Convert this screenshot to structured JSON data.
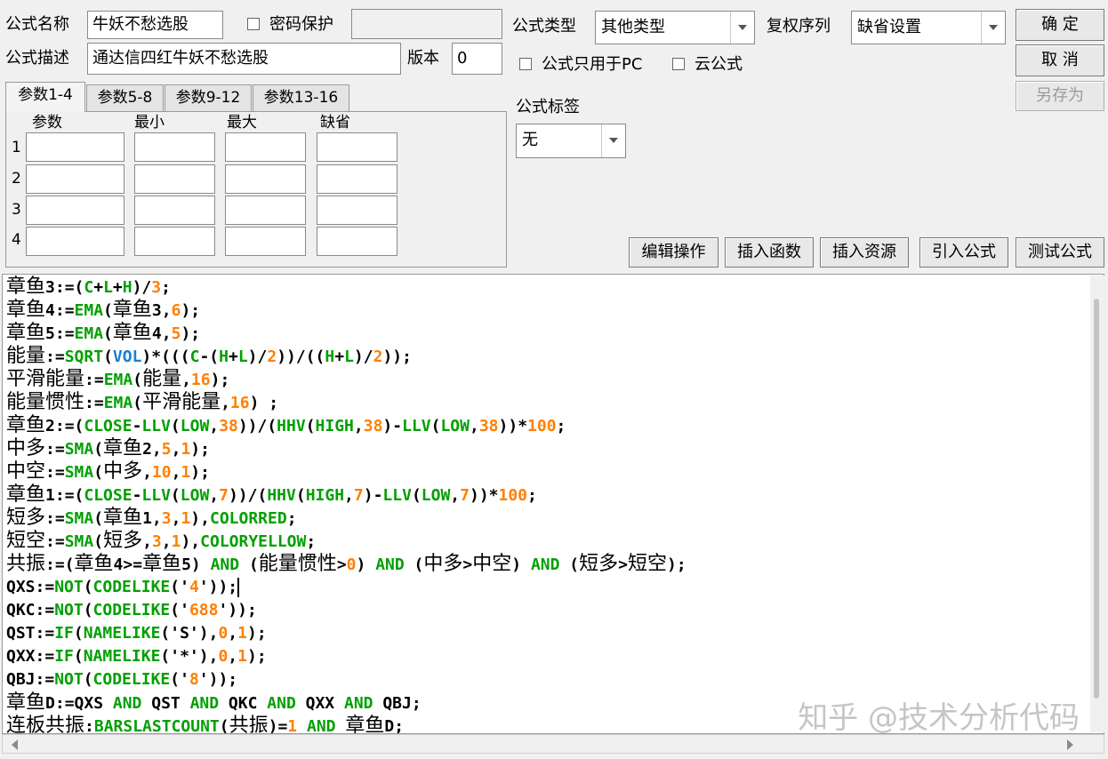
{
  "header": {
    "name_label": "公式名称",
    "name_value": "牛妖不愁选股",
    "password_label": "密码保护",
    "password_value": "",
    "desc_label": "公式描述",
    "desc_value": "通达信四红牛妖不愁选股",
    "version_label": "版本",
    "version_value": "0",
    "type_label": "公式类型",
    "type_value": "其他类型",
    "rights_label": "复权序列",
    "rights_value": "缺省设置",
    "pc_only_label": "公式只用于PC",
    "cloud_label": "云公式",
    "tag_label": "公式标签",
    "tag_value": "无"
  },
  "buttons": {
    "ok": "确  定",
    "cancel": "取  消",
    "save_as": "另存为",
    "edit_ops": "编辑操作",
    "insert_func": "插入函数",
    "insert_res": "插入资源",
    "import_formula": "引入公式",
    "test_formula": "测试公式"
  },
  "params": {
    "tabs": [
      "参数1-4",
      "参数5-8",
      "参数9-12",
      "参数13-16"
    ],
    "active_tab": 0,
    "columns": [
      "参数",
      "最小",
      "最大",
      "缺省"
    ],
    "rows": [
      "1",
      "2",
      "3",
      "4"
    ]
  },
  "editor": {
    "lines": [
      [
        [
          "章鱼",
          "cn"
        ],
        [
          "3:=(",
          ""
        ],
        [
          "C",
          "g"
        ],
        [
          "+",
          ""
        ],
        [
          "L",
          "g"
        ],
        [
          "+",
          ""
        ],
        [
          "H",
          "g"
        ],
        [
          ")/",
          ""
        ],
        [
          "3",
          "o"
        ],
        [
          ";",
          ""
        ]
      ],
      [
        [
          "章鱼",
          "cn"
        ],
        [
          "4:=",
          ""
        ],
        [
          "EMA",
          "g"
        ],
        [
          "(",
          ""
        ],
        [
          "章鱼",
          "cn"
        ],
        [
          "3,",
          ""
        ],
        [
          "6",
          "o"
        ],
        [
          ");",
          ""
        ]
      ],
      [
        [
          "章鱼",
          "cn"
        ],
        [
          "5:=",
          ""
        ],
        [
          "EMA",
          "g"
        ],
        [
          "(",
          ""
        ],
        [
          "章鱼",
          "cn"
        ],
        [
          "4,",
          ""
        ],
        [
          "5",
          "o"
        ],
        [
          ");",
          ""
        ]
      ],
      [
        [
          "能量",
          "cn"
        ],
        [
          ":=",
          ""
        ],
        [
          "SQRT",
          "g"
        ],
        [
          "(",
          ""
        ],
        [
          "VOL",
          "b"
        ],
        [
          ")*(((",
          ""
        ],
        [
          "C",
          "g"
        ],
        [
          "-(",
          ""
        ],
        [
          "H",
          "g"
        ],
        [
          "+",
          ""
        ],
        [
          "L",
          "g"
        ],
        [
          ")/",
          ""
        ],
        [
          "2",
          "o"
        ],
        [
          "))/((",
          ""
        ],
        [
          "H",
          "g"
        ],
        [
          "+",
          ""
        ],
        [
          "L",
          "g"
        ],
        [
          ")/",
          ""
        ],
        [
          "2",
          "o"
        ],
        [
          "));",
          ""
        ]
      ],
      [
        [
          "平滑能量",
          "cn"
        ],
        [
          ":=",
          ""
        ],
        [
          "EMA",
          "g"
        ],
        [
          "(",
          ""
        ],
        [
          "能量",
          "cn"
        ],
        [
          ",",
          ""
        ],
        [
          "16",
          "o"
        ],
        [
          ");",
          ""
        ]
      ],
      [
        [
          "能量惯性",
          "cn"
        ],
        [
          ":=",
          ""
        ],
        [
          "EMA",
          "g"
        ],
        [
          "(",
          ""
        ],
        [
          "平滑能量",
          "cn"
        ],
        [
          ",",
          ""
        ],
        [
          "16",
          "o"
        ],
        [
          ") ;",
          ""
        ]
      ],
      [
        [
          "章鱼",
          "cn"
        ],
        [
          "2:=(",
          ""
        ],
        [
          "CLOSE",
          "g"
        ],
        [
          "-",
          ""
        ],
        [
          "LLV",
          "g"
        ],
        [
          "(",
          ""
        ],
        [
          "LOW",
          "g"
        ],
        [
          ",",
          ""
        ],
        [
          "38",
          "o"
        ],
        [
          "))/(",
          ""
        ],
        [
          "HHV",
          "g"
        ],
        [
          "(",
          ""
        ],
        [
          "HIGH",
          "g"
        ],
        [
          ",",
          ""
        ],
        [
          "38",
          "o"
        ],
        [
          ")-",
          ""
        ],
        [
          "LLV",
          "g"
        ],
        [
          "(",
          ""
        ],
        [
          "LOW",
          "g"
        ],
        [
          ",",
          ""
        ],
        [
          "38",
          "o"
        ],
        [
          "))*",
          ""
        ],
        [
          "100",
          "o"
        ],
        [
          ";",
          ""
        ]
      ],
      [
        [
          "中多",
          "cn"
        ],
        [
          ":=",
          ""
        ],
        [
          "SMA",
          "g"
        ],
        [
          "(",
          ""
        ],
        [
          "章鱼",
          "cn"
        ],
        [
          "2,",
          ""
        ],
        [
          "5",
          "o"
        ],
        [
          ",",
          ""
        ],
        [
          "1",
          "o"
        ],
        [
          ");",
          ""
        ]
      ],
      [
        [
          "中空",
          "cn"
        ],
        [
          ":=",
          ""
        ],
        [
          "SMA",
          "g"
        ],
        [
          "(",
          ""
        ],
        [
          "中多",
          "cn"
        ],
        [
          ",",
          ""
        ],
        [
          "10",
          "o"
        ],
        [
          ",",
          ""
        ],
        [
          "1",
          "o"
        ],
        [
          ");",
          ""
        ]
      ],
      [
        [
          "章鱼",
          "cn"
        ],
        [
          "1:=(",
          ""
        ],
        [
          "CLOSE",
          "g"
        ],
        [
          "-",
          ""
        ],
        [
          "LLV",
          "g"
        ],
        [
          "(",
          ""
        ],
        [
          "LOW",
          "g"
        ],
        [
          ",",
          ""
        ],
        [
          "7",
          "o"
        ],
        [
          "))/(",
          ""
        ],
        [
          "HHV",
          "g"
        ],
        [
          "(",
          ""
        ],
        [
          "HIGH",
          "g"
        ],
        [
          ",",
          ""
        ],
        [
          "7",
          "o"
        ],
        [
          ")-",
          ""
        ],
        [
          "LLV",
          "g"
        ],
        [
          "(",
          ""
        ],
        [
          "LOW",
          "g"
        ],
        [
          ",",
          ""
        ],
        [
          "7",
          "o"
        ],
        [
          "))*",
          ""
        ],
        [
          "100",
          "o"
        ],
        [
          ";",
          ""
        ]
      ],
      [
        [
          "短多",
          "cn"
        ],
        [
          ":=",
          ""
        ],
        [
          "SMA",
          "g"
        ],
        [
          "(",
          ""
        ],
        [
          "章鱼",
          "cn"
        ],
        [
          "1,",
          ""
        ],
        [
          "3",
          "o"
        ],
        [
          ",",
          ""
        ],
        [
          "1",
          "o"
        ],
        [
          "),",
          ""
        ],
        [
          "COLORRED",
          "g"
        ],
        [
          ";",
          ""
        ]
      ],
      [
        [
          "短空",
          "cn"
        ],
        [
          ":=",
          ""
        ],
        [
          "SMA",
          "g"
        ],
        [
          "(",
          ""
        ],
        [
          "短多",
          "cn"
        ],
        [
          ",",
          ""
        ],
        [
          "3",
          "o"
        ],
        [
          ",",
          ""
        ],
        [
          "1",
          "o"
        ],
        [
          "),",
          ""
        ],
        [
          "COLORYELLOW",
          "g"
        ],
        [
          ";",
          ""
        ]
      ],
      [
        [
          "共振",
          "cn"
        ],
        [
          ":=(",
          ""
        ],
        [
          "章鱼",
          "cn"
        ],
        [
          "4>=",
          ""
        ],
        [
          "章鱼",
          "cn"
        ],
        [
          "5) ",
          ""
        ],
        [
          "AND",
          "g"
        ],
        [
          " (",
          ""
        ],
        [
          "能量惯性",
          "cn"
        ],
        [
          ">",
          ""
        ],
        [
          "0",
          "o"
        ],
        [
          ") ",
          ""
        ],
        [
          "AND",
          "g"
        ],
        [
          " (",
          ""
        ],
        [
          "中多",
          "cn"
        ],
        [
          ">",
          ""
        ],
        [
          "中空",
          "cn"
        ],
        [
          ") ",
          ""
        ],
        [
          "AND",
          "g"
        ],
        [
          " (",
          ""
        ],
        [
          "短多",
          "cn"
        ],
        [
          ">",
          ""
        ],
        [
          "短空",
          "cn"
        ],
        [
          ");",
          ""
        ]
      ],
      [
        [
          "QXS:=",
          ""
        ],
        [
          "NOT",
          "g"
        ],
        [
          "(",
          ""
        ],
        [
          "CODELIKE",
          "g"
        ],
        [
          "('",
          ""
        ],
        [
          "4",
          "o"
        ],
        [
          "'));",
          ""
        ]
      ],
      [
        [
          "QKC:=",
          ""
        ],
        [
          "NOT",
          "g"
        ],
        [
          "(",
          ""
        ],
        [
          "CODELIKE",
          "g"
        ],
        [
          "('",
          ""
        ],
        [
          "688",
          "o"
        ],
        [
          "'));",
          ""
        ]
      ],
      [
        [
          "QST:=",
          ""
        ],
        [
          "IF",
          "g"
        ],
        [
          "(",
          ""
        ],
        [
          "NAMELIKE",
          "g"
        ],
        [
          "('S'),",
          ""
        ],
        [
          "0",
          "o"
        ],
        [
          ",",
          ""
        ],
        [
          "1",
          "o"
        ],
        [
          ");",
          ""
        ]
      ],
      [
        [
          "QXX:=",
          ""
        ],
        [
          "IF",
          "g"
        ],
        [
          "(",
          ""
        ],
        [
          "NAMELIKE",
          "g"
        ],
        [
          "('*'),",
          ""
        ],
        [
          "0",
          "o"
        ],
        [
          ",",
          ""
        ],
        [
          "1",
          "o"
        ],
        [
          ");",
          ""
        ]
      ],
      [
        [
          "QBJ:=",
          ""
        ],
        [
          "NOT",
          "g"
        ],
        [
          "(",
          ""
        ],
        [
          "CODELIKE",
          "g"
        ],
        [
          "('",
          ""
        ],
        [
          "8",
          "o"
        ],
        [
          "'));",
          ""
        ]
      ],
      [
        [
          "章鱼",
          "cn"
        ],
        [
          "D:=QXS ",
          ""
        ],
        [
          "AND",
          "g"
        ],
        [
          " QST ",
          ""
        ],
        [
          "AND",
          "g"
        ],
        [
          " QKC ",
          ""
        ],
        [
          "AND",
          "g"
        ],
        [
          " QXX ",
          ""
        ],
        [
          "AND",
          "g"
        ],
        [
          " QBJ;",
          ""
        ]
      ],
      [
        [
          "连板共振",
          "cn"
        ],
        [
          ":",
          ""
        ],
        [
          "BARSLASTCOUNT",
          "g"
        ],
        [
          "(",
          ""
        ],
        [
          "共振",
          "cn"
        ],
        [
          ")=",
          ""
        ],
        [
          "1",
          "o"
        ],
        [
          " ",
          ""
        ],
        [
          "AND",
          "g"
        ],
        [
          " ",
          ""
        ],
        [
          "章鱼",
          "cn"
        ],
        [
          "D;",
          ""
        ]
      ]
    ]
  },
  "watermark": "知乎 @技术分析代码"
}
